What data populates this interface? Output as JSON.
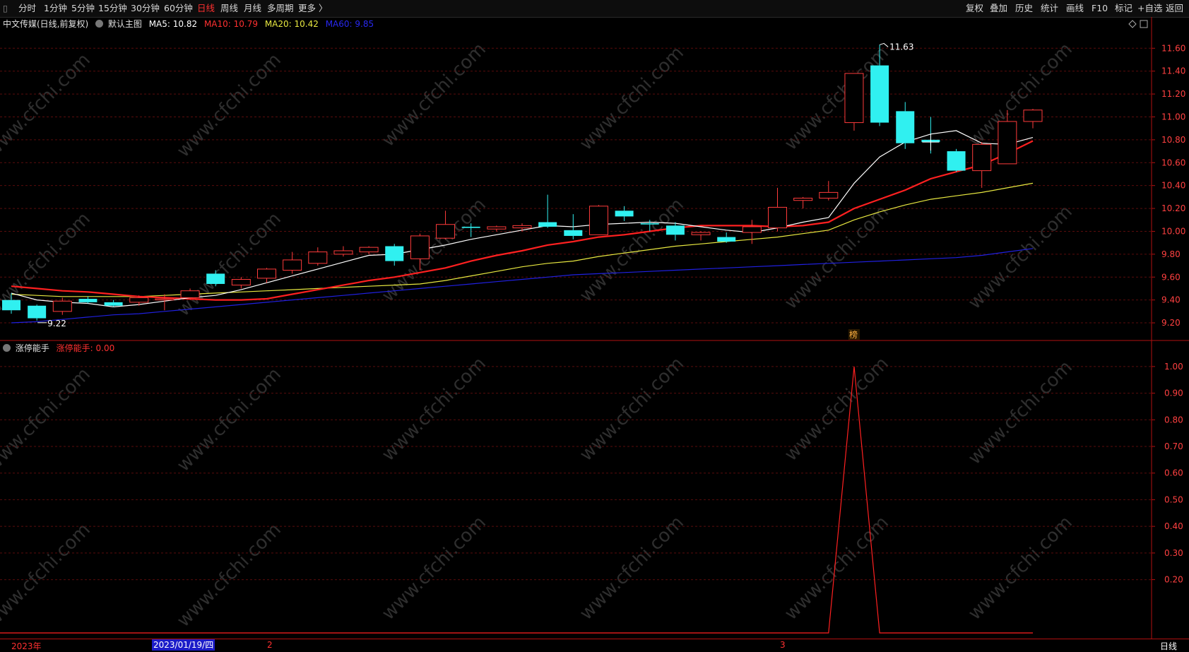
{
  "toolbar": {
    "left_items": [
      {
        "label": "分时",
        "x": 26
      },
      {
        "label": "1分钟",
        "x": 62
      },
      {
        "label": "5分钟",
        "x": 101
      },
      {
        "label": "15分钟",
        "x": 139
      },
      {
        "label": "30分钟",
        "x": 185
      },
      {
        "label": "60分钟",
        "x": 232
      },
      {
        "label": "日线",
        "x": 279,
        "active": true
      },
      {
        "label": "周线",
        "x": 312
      },
      {
        "label": "月线",
        "x": 345
      },
      {
        "label": "多周期",
        "x": 378
      },
      {
        "label": "更多 〉",
        "x": 422
      }
    ],
    "right_items": [
      {
        "label": "复权",
        "x": 1367
      },
      {
        "label": "叠加",
        "x": 1401
      },
      {
        "label": "历史",
        "x": 1437
      },
      {
        "label": "统计",
        "x": 1473
      },
      {
        "label": "画线",
        "x": 1509
      },
      {
        "label": "F10",
        "x": 1545
      },
      {
        "label": "标记",
        "x": 1578
      },
      {
        "label": "+自选",
        "x": 1610
      },
      {
        "label": "返回",
        "x": 1650
      }
    ]
  },
  "main_legend": {
    "stock": "中文传媒(日线,前复权)",
    "template": "默认主图",
    "ma5": "MA5: 10.82",
    "ma10": "MA10: 10.79",
    "ma20": "MA20: 10.42",
    "ma60": "MA60: 9.85"
  },
  "sub_legend": {
    "name": "涨停能手",
    "value": "涨停能手: 0.00"
  },
  "annotations": {
    "high": "11.63",
    "low": "9.22",
    "badge": "榜"
  },
  "bottom": {
    "year_label": "2023年",
    "cursor_date": "2023/01/19/四",
    "month_feb": "2",
    "month_mar": "3",
    "period": "日线"
  },
  "watermark": "www.cfchi.com",
  "colors": {
    "up": "#ff3b3b",
    "down": "#30f0f0",
    "ma5": "#ffffff",
    "ma10": "#ff2020",
    "ma20": "#e8e840",
    "ma60": "#2020e0",
    "axis": "#b01010",
    "signal": "#ff2020"
  },
  "chart_data": [
    {
      "type": "candlestick",
      "y_axis_ticks": [
        "11.60",
        "11.40",
        "11.20",
        "11.00",
        "10.80",
        "10.60",
        "10.40",
        "10.20",
        "10.00",
        "9.80",
        "9.60",
        "9.40",
        "9.20"
      ],
      "ylim": [
        9.12,
        11.75
      ],
      "candles": [
        {
          "o": 9.4,
          "h": 9.46,
          "l": 9.28,
          "c": 9.31
        },
        {
          "o": 9.35,
          "h": 9.36,
          "l": 9.22,
          "c": 9.24
        },
        {
          "o": 9.3,
          "h": 9.42,
          "l": 9.27,
          "c": 9.39
        },
        {
          "o": 9.41,
          "h": 9.43,
          "l": 9.37,
          "c": 9.38
        },
        {
          "o": 9.38,
          "h": 9.4,
          "l": 9.34,
          "c": 9.35
        },
        {
          "o": 9.38,
          "h": 9.44,
          "l": 9.35,
          "c": 9.42
        },
        {
          "o": 9.4,
          "h": 9.45,
          "l": 9.31,
          "c": 9.41
        },
        {
          "o": 9.42,
          "h": 9.5,
          "l": 9.4,
          "c": 9.48
        },
        {
          "o": 9.63,
          "h": 9.66,
          "l": 9.52,
          "c": 9.54
        },
        {
          "o": 9.53,
          "h": 9.6,
          "l": 9.5,
          "c": 9.58
        },
        {
          "o": 9.59,
          "h": 9.68,
          "l": 9.55,
          "c": 9.67
        },
        {
          "o": 9.66,
          "h": 9.82,
          "l": 9.63,
          "c": 9.75
        },
        {
          "o": 9.72,
          "h": 9.86,
          "l": 9.7,
          "c": 9.82
        },
        {
          "o": 9.8,
          "h": 9.87,
          "l": 9.78,
          "c": 9.83
        },
        {
          "o": 9.82,
          "h": 9.87,
          "l": 9.8,
          "c": 9.86
        },
        {
          "o": 9.87,
          "h": 9.89,
          "l": 9.7,
          "c": 9.74
        },
        {
          "o": 9.76,
          "h": 9.98,
          "l": 9.66,
          "c": 9.96
        },
        {
          "o": 9.94,
          "h": 10.18,
          "l": 9.93,
          "c": 10.06
        },
        {
          "o": 10.04,
          "h": 10.07,
          "l": 9.95,
          "c": 10.03
        },
        {
          "o": 10.02,
          "h": 10.05,
          "l": 10.0,
          "c": 10.04
        },
        {
          "o": 10.03,
          "h": 10.07,
          "l": 10.0,
          "c": 10.05
        },
        {
          "o": 10.08,
          "h": 10.32,
          "l": 10.03,
          "c": 10.04
        },
        {
          "o": 10.01,
          "h": 10.15,
          "l": 9.93,
          "c": 9.96
        },
        {
          "o": 9.97,
          "h": 10.23,
          "l": 9.97,
          "c": 10.22
        },
        {
          "o": 10.18,
          "h": 10.22,
          "l": 10.09,
          "c": 10.13
        },
        {
          "o": 10.07,
          "h": 10.1,
          "l": 10.0,
          "c": 10.06
        },
        {
          "o": 10.05,
          "h": 10.08,
          "l": 9.92,
          "c": 9.97
        },
        {
          "o": 9.97,
          "h": 10.0,
          "l": 9.92,
          "c": 9.99
        },
        {
          "o": 9.95,
          "h": 9.99,
          "l": 9.9,
          "c": 9.91
        },
        {
          "o": 9.99,
          "h": 10.1,
          "l": 9.89,
          "c": 10.04
        },
        {
          "o": 10.03,
          "h": 10.38,
          "l": 10.0,
          "c": 10.21
        },
        {
          "o": 10.27,
          "h": 10.3,
          "l": 10.2,
          "c": 10.29
        },
        {
          "o": 10.29,
          "h": 10.44,
          "l": 10.27,
          "c": 10.34
        },
        {
          "o": 10.95,
          "h": 11.38,
          "l": 10.88,
          "c": 11.38
        },
        {
          "o": 11.45,
          "h": 11.63,
          "l": 10.92,
          "c": 10.95
        },
        {
          "o": 11.05,
          "h": 11.13,
          "l": 10.72,
          "c": 10.77
        },
        {
          "o": 10.8,
          "h": 11.0,
          "l": 10.68,
          "c": 10.78
        },
        {
          "o": 10.7,
          "h": 10.72,
          "l": 10.52,
          "c": 10.53
        },
        {
          "o": 10.53,
          "h": 10.78,
          "l": 10.38,
          "c": 10.76
        },
        {
          "o": 10.59,
          "h": 11.06,
          "l": 10.59,
          "c": 10.96
        },
        {
          "o": 10.96,
          "h": 11.07,
          "l": 10.9,
          "c": 11.06
        }
      ],
      "ma5": [
        9.46,
        9.4,
        9.38,
        9.37,
        9.34,
        9.36,
        9.39,
        9.42,
        9.44,
        9.49,
        9.55,
        9.61,
        9.67,
        9.73,
        9.79,
        9.8,
        9.84,
        9.88,
        9.93,
        9.97,
        10.01,
        10.05,
        10.04,
        10.06,
        10.07,
        10.08,
        10.07,
        10.04,
        10.01,
        9.99,
        10.03,
        10.08,
        10.12,
        10.42,
        10.65,
        10.78,
        10.85,
        10.88,
        10.77,
        10.76,
        10.82
      ],
      "ma10": [
        9.52,
        9.5,
        9.48,
        9.47,
        9.45,
        9.43,
        9.42,
        9.41,
        9.4,
        9.4,
        9.41,
        9.45,
        9.49,
        9.53,
        9.57,
        9.6,
        9.64,
        9.68,
        9.74,
        9.79,
        9.83,
        9.88,
        9.91,
        9.95,
        9.97,
        10.0,
        10.03,
        10.05,
        10.05,
        10.05,
        10.04,
        10.05,
        10.08,
        10.2,
        10.28,
        10.36,
        10.46,
        10.52,
        10.58,
        10.68,
        10.79
      ],
      "ma20": [
        9.45,
        9.44,
        9.43,
        9.43,
        9.43,
        9.43,
        9.44,
        9.45,
        9.46,
        9.47,
        9.48,
        9.49,
        9.5,
        9.51,
        9.52,
        9.53,
        9.54,
        9.57,
        9.61,
        9.65,
        9.69,
        9.72,
        9.74,
        9.78,
        9.81,
        9.84,
        9.87,
        9.89,
        9.91,
        9.93,
        9.95,
        9.98,
        10.01,
        10.1,
        10.17,
        10.23,
        10.28,
        10.31,
        10.34,
        10.38,
        10.42
      ],
      "ma60": [
        9.2,
        9.21,
        9.23,
        9.25,
        9.27,
        9.28,
        9.3,
        9.32,
        9.34,
        9.36,
        9.38,
        9.4,
        9.42,
        9.44,
        9.46,
        9.48,
        9.5,
        9.52,
        9.54,
        9.56,
        9.58,
        9.6,
        9.62,
        9.63,
        9.64,
        9.65,
        9.66,
        9.67,
        9.68,
        9.69,
        9.7,
        9.71,
        9.72,
        9.73,
        9.74,
        9.75,
        9.76,
        9.77,
        9.79,
        9.82,
        9.85
      ]
    },
    {
      "type": "line",
      "name": "涨停能手",
      "y_axis_ticks": [
        "1.00",
        "0.90",
        "0.80",
        "0.70",
        "0.60",
        "0.50",
        "0.40",
        "0.30",
        "0.20"
      ],
      "ylim": [
        0,
        1.05
      ],
      "values": [
        0,
        0,
        0,
        0,
        0,
        0,
        0,
        0,
        0,
        0,
        0,
        0,
        0,
        0,
        0,
        0,
        0,
        0,
        0,
        0,
        0,
        0,
        0,
        0,
        0,
        0,
        0,
        0,
        0,
        0,
        0,
        0,
        0,
        1,
        0,
        0,
        0,
        0,
        0,
        0,
        0
      ]
    }
  ]
}
